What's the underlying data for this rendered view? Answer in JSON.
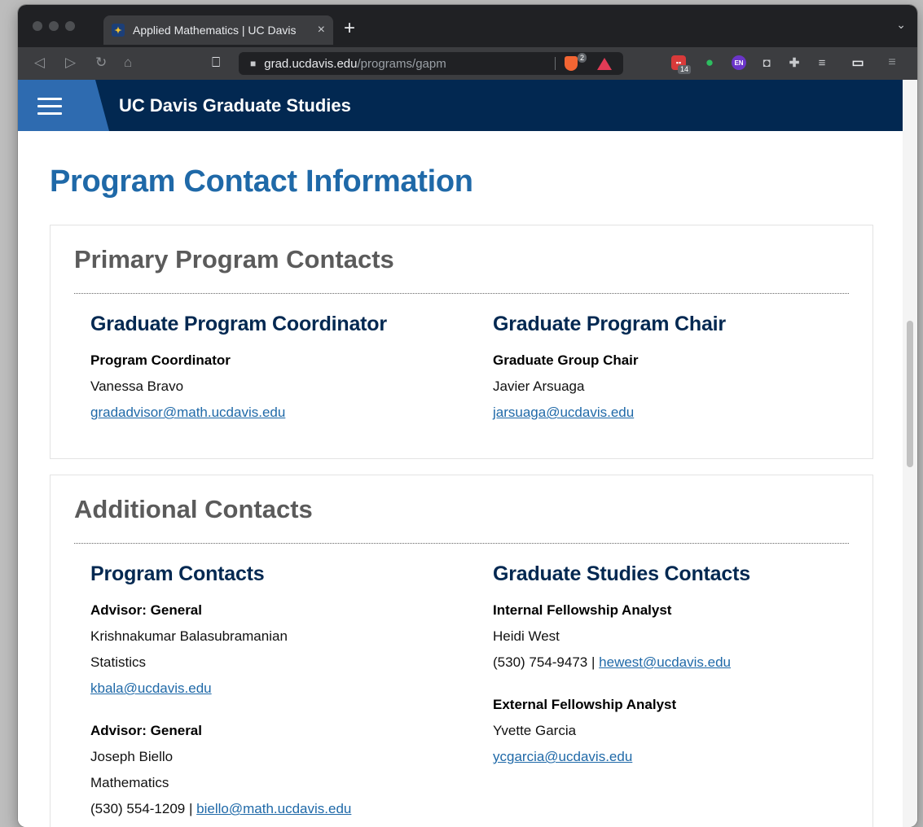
{
  "browser": {
    "tab_title": "Applied Mathematics | UC Davis",
    "tab_close": "×",
    "new_tab": "+",
    "tab_menu": "⌄",
    "url_host": "grad.ucdavis.edu",
    "url_path": "/programs/gapm",
    "brave_shield_count": "2",
    "calendar_badge": "14",
    "ext_en_label": "EN",
    "icons": [
      "back-icon",
      "forward-icon",
      "reload-icon",
      "home-icon",
      "bookmark-icon",
      "lock-icon",
      "brave-shield-icon",
      "brave-rewards-icon",
      "calendar-extension-icon",
      "evernote-icon",
      "en-extension-icon",
      "extension-icon",
      "puzzle-icon",
      "reading-list-icon",
      "wallet-icon",
      "menu-icon"
    ]
  },
  "site": {
    "title": "UC Davis Graduate Studies"
  },
  "page": {
    "title": "Program Contact Information"
  },
  "primary": {
    "heading": "Primary Program Contacts",
    "coordinator": {
      "heading": "Graduate Program Coordinator",
      "role": "Program Coordinator",
      "name": "Vanessa Bravo",
      "email": "gradadvisor@math.ucdavis.edu"
    },
    "chair": {
      "heading": "Graduate Program Chair",
      "role": "Graduate Group Chair",
      "name": "Javier Arsuaga",
      "email": "jarsuaga@ucdavis.edu"
    }
  },
  "additional": {
    "heading": "Additional Contacts",
    "program_contacts": {
      "heading": "Program Contacts",
      "contacts": [
        {
          "role": "Advisor: General",
          "name": "Krishnakumar Balasubramanian",
          "dept": "Statistics",
          "email": "kbala@ucdavis.edu"
        },
        {
          "role": "Advisor: General",
          "name": "Joseph Biello",
          "dept": "Mathematics",
          "phone": "(530) 554-1209",
          "email": "biello@math.ucdavis.edu"
        }
      ]
    },
    "grad_studies_contacts": {
      "heading": "Graduate Studies Contacts",
      "contacts": [
        {
          "role": "Internal Fellowship Analyst",
          "name": "Heidi West",
          "phone": "(530) 754-9473",
          "email": "hewest@ucdavis.edu"
        },
        {
          "role": "External Fellowship Analyst",
          "name": "Yvette Garcia",
          "email": "ycgarcia@ucdavis.edu"
        }
      ]
    }
  },
  "separator": "|",
  "colors": {
    "header_navy": "#022851",
    "accent_blue": "#1f69a8",
    "menu_blue": "#2e6bb0",
    "heading_gray": "#5b5b5b"
  }
}
